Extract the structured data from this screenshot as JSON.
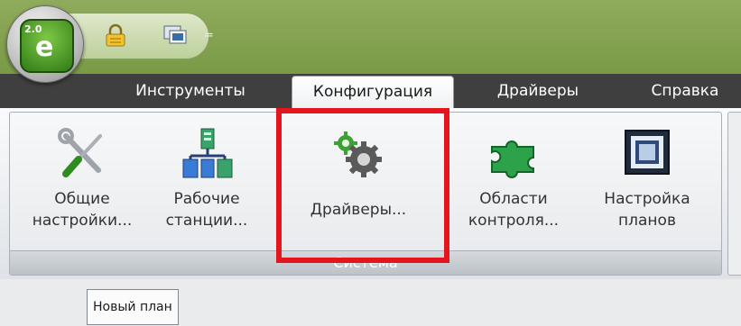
{
  "app": {
    "logo_badge": "2.0",
    "logo_letter": "e"
  },
  "quick_access": {
    "separator": "="
  },
  "tabs": [
    {
      "label": "Инструменты"
    },
    {
      "label": "Конфигурация",
      "active": true
    },
    {
      "label": "Драйверы"
    },
    {
      "label": "Справка"
    }
  ],
  "ribbon": {
    "group_label": "Система",
    "buttons": [
      {
        "label": "Общие\nнастройки...",
        "icon": "tools-icon"
      },
      {
        "label": "Рабочие\nстанции...",
        "icon": "network-icon"
      },
      {
        "label": "Драйверы...",
        "icon": "gears-icon",
        "highlighted": true
      },
      {
        "label": "Области\nконтроля...",
        "icon": "puzzle-icon"
      },
      {
        "label": "Настройка\nпланов",
        "icon": "frame-icon"
      }
    ]
  },
  "document_tabs": [
    {
      "label": "Новый план"
    }
  ],
  "colors": {
    "highlight": "#e5151d",
    "tab_strip": "#3f3f3f",
    "title_bar": "#7a9a47"
  }
}
